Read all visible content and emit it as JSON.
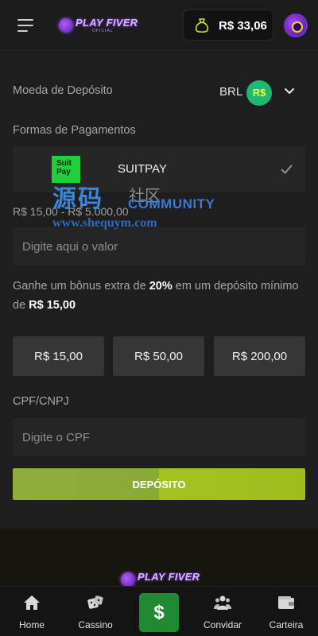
{
  "header": {
    "logo_text": "PLAY FIVER",
    "logo_sub": "OFICIAL",
    "balance": "R$ 33,06"
  },
  "deposit": {
    "currency_label": "Moeda de Depósito",
    "currency_code": "BRL",
    "currency_symbol": "R$",
    "payment_methods_label": "Formas de Pagamentos",
    "method": {
      "logo_text": "Suit Pay",
      "name": "SUITPAY",
      "selected": true
    },
    "range_text": "R$ 15,00 - R$ 5.000,00",
    "amount_placeholder": "Digite aqui o valor",
    "bonus": {
      "prefix": "Ganhe um bônus extra de",
      "percent": "20%",
      "middle": "em um depósito mínimo de",
      "min_value": "R$ 15,00"
    },
    "amount_options": [
      "R$ 15,00",
      "R$ 50,00",
      "R$ 200,00"
    ],
    "cpf_label": "CPF/CNPJ",
    "cpf_placeholder": "Digite o CPF",
    "submit_label": "DEPÓSITO"
  },
  "watermark": {
    "cn_main": "源码",
    "cn_sub": "社区",
    "community": "COMMUNITY",
    "url": "www.shequym.com"
  },
  "footer": {
    "logo_text": "PLAY FIVER"
  },
  "bottom_nav": {
    "items": [
      {
        "label": "Home",
        "icon": "home-icon"
      },
      {
        "label": "Cassino",
        "icon": "dice-icon"
      },
      {
        "label": "$",
        "icon": "dollar-icon"
      },
      {
        "label": "Convidar",
        "icon": "users-icon"
      },
      {
        "label": "Carteira",
        "icon": "wallet-icon"
      }
    ]
  },
  "colors": {
    "accent_green": "#1f8a31",
    "deposit_button": "#9fbd1e",
    "brand_purple": "#8a3cff",
    "currency_badge": "#1fb870"
  }
}
